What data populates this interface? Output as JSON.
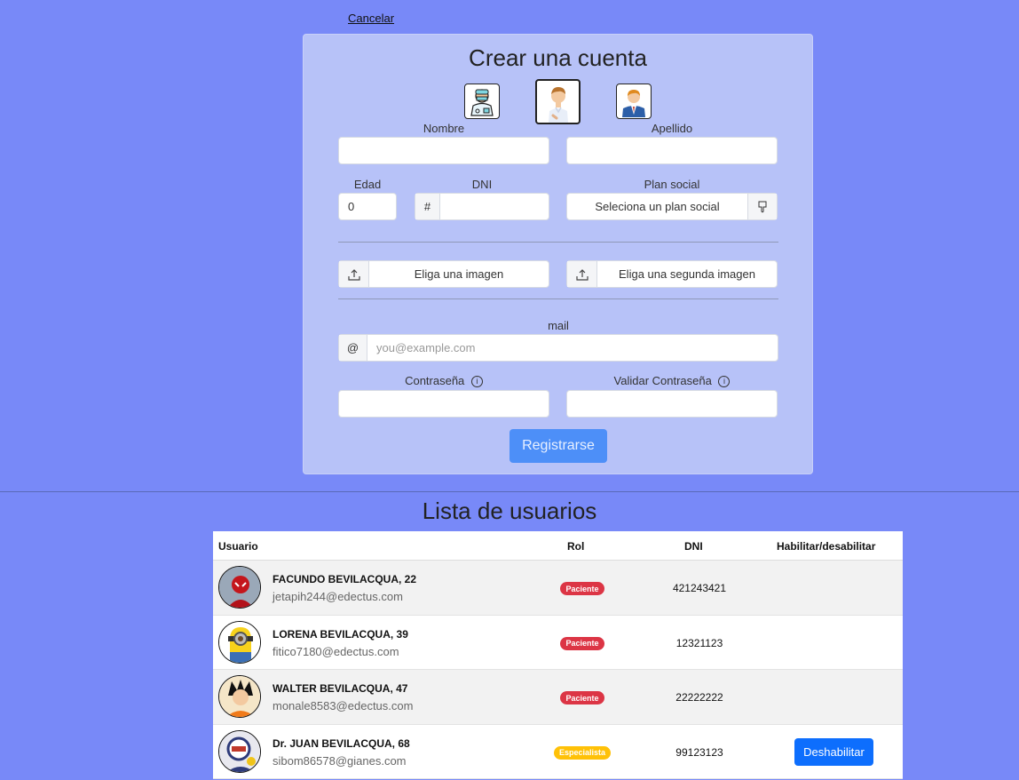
{
  "cancel_link": "Cancelar",
  "form": {
    "title": "Crear una cuenta",
    "nombre_label": "Nombre",
    "apellido_label": "Apellido",
    "edad_label": "Edad",
    "edad_value": "0",
    "dni_label": "DNI",
    "dni_prefix": "#",
    "plan_label": "Plan social",
    "plan_select": "Seleciona un plan social",
    "image1_label": "Eliga una imagen",
    "image2_label": "Eliga una segunda imagen",
    "mail_label": "mail",
    "mail_prefix": "@",
    "mail_placeholder": "you@example.com",
    "password_label": "Contraseña",
    "password_confirm_label": "Validar Contraseña",
    "submit_label": "Registrarse",
    "role_icons": [
      "doctor-icon",
      "patient-icon",
      "admin-icon"
    ]
  },
  "users": {
    "title": "Lista de usuarios",
    "columns": [
      "Usuario",
      "Rol",
      "DNI",
      "Habilitar/desabilitar"
    ],
    "rows": [
      {
        "name": "FACUNDO BEVILACQUA, 22",
        "email": "jetapih244@edectus.com",
        "role": "Paciente",
        "dni": "421243421",
        "action": ""
      },
      {
        "name": "LORENA BEVILACQUA, 39",
        "email": "fitico7180@edectus.com",
        "role": "Paciente",
        "dni": "12321123",
        "action": ""
      },
      {
        "name": "WALTER BEVILACQUA, 47",
        "email": "monale8583@edectus.com",
        "role": "Paciente",
        "dni": "22222222",
        "action": ""
      },
      {
        "name": "Dr. JUAN BEVILACQUA, 68",
        "email": "sibom86578@gianes.com",
        "role": "Especialista",
        "dni": "99123123",
        "action": "Deshabilitar"
      }
    ]
  },
  "colors": {
    "background": "#7889f8",
    "card": "#b7c2f8",
    "primary": "#0d6efd",
    "paciente_badge": "#dc3545",
    "especialista_badge": "#ffc107"
  }
}
